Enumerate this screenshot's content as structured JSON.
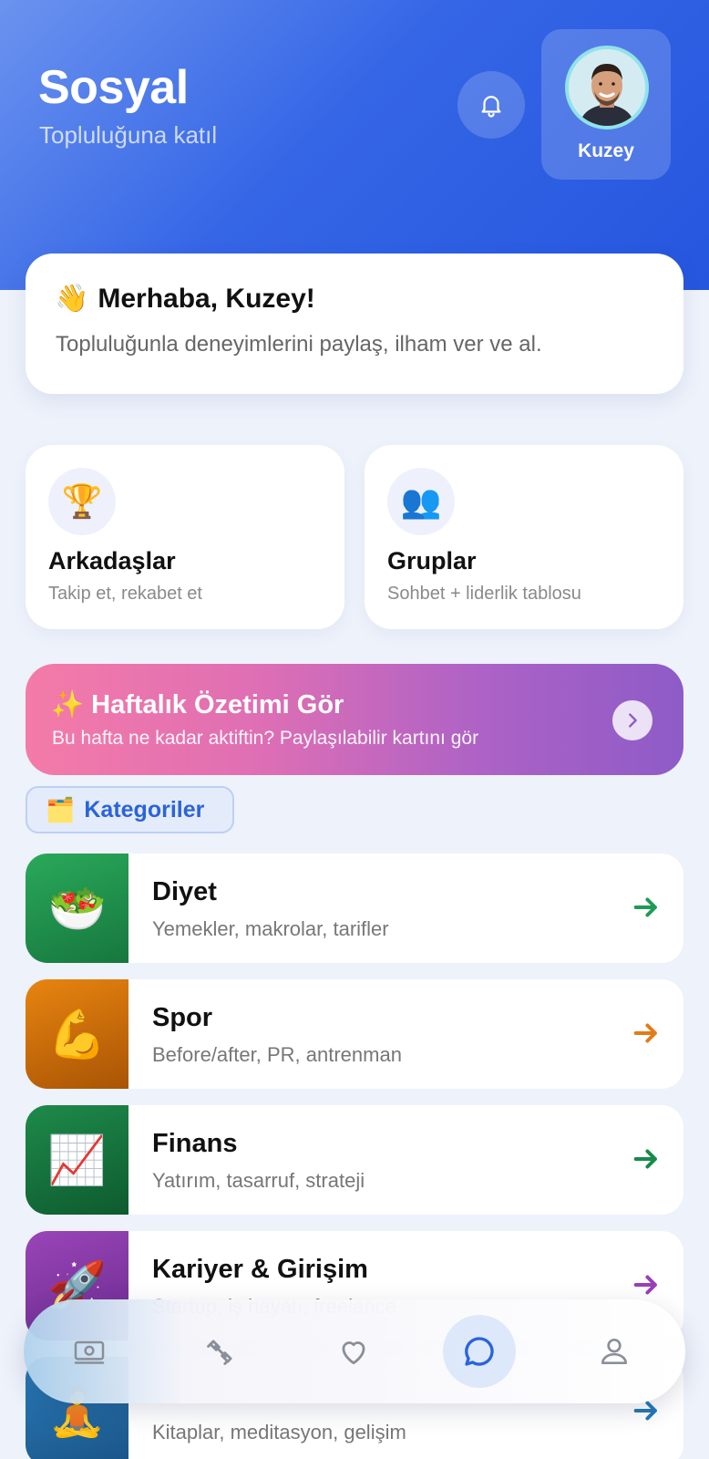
{
  "header": {
    "title": "Sosyal",
    "subtitle": "Topluluğuna katıl",
    "notification_icon": "bell-icon",
    "profile": {
      "name": "Kuzey",
      "avatar": "avatar-photo"
    }
  },
  "greeting": {
    "emoji": "👋",
    "title": "Merhaba, Kuzey!",
    "text": "Topluluğunla deneyimlerini paylaş, ilham ver ve al."
  },
  "quick_cards": [
    {
      "icon": "🏆",
      "title": "Arkadaşlar",
      "subtitle": "Takip et, rekabet et"
    },
    {
      "icon": "👥",
      "title": "Gruplar",
      "subtitle": "Sohbet + liderlik tablosu"
    }
  ],
  "weekly": {
    "title": "✨ Haftalık Özetimi Gör",
    "subtitle": "Bu hafta ne kadar aktiftin? Paylaşılabilir kartını gör"
  },
  "categories": {
    "emoji": "🗂️",
    "label": "Kategoriler",
    "items": [
      {
        "icon": "🥗",
        "title": "Diyet",
        "subtitle": "Yemekler, makrolar, tarifler",
        "color": "#1e9c54",
        "thumb_from": "#2aa95a",
        "thumb_to": "#16773e"
      },
      {
        "icon": "💪",
        "title": "Spor",
        "subtitle": "Before/after, PR, antrenman",
        "color": "#e27c17",
        "thumb_from": "#e88510",
        "thumb_to": "#a95405"
      },
      {
        "icon": "📈",
        "title": "Finans",
        "subtitle": "Yatırım, tasarruf, strateji",
        "color": "#188a4a",
        "thumb_from": "#1e8a4a",
        "thumb_to": "#0e5b2f"
      },
      {
        "icon": "🚀",
        "title": "Kariyer & Girişim",
        "subtitle": "Startup, iş hayatı, freelance",
        "color": "#9a3fb8",
        "thumb_from": "#9a45b8",
        "thumb_to": "#6a2b8e"
      },
      {
        "icon": "🧘",
        "title": "",
        "subtitle": "Kitaplar, meditasyon, gelişim",
        "color": "#2479b5",
        "thumb_from": "#2a7dbb",
        "thumb_to": "#1a5486"
      }
    ]
  },
  "tabbar": {
    "tabs": [
      "money-icon",
      "dumbbell-icon",
      "heart-icon",
      "chat-icon",
      "person-icon"
    ],
    "active": "chat-icon"
  }
}
